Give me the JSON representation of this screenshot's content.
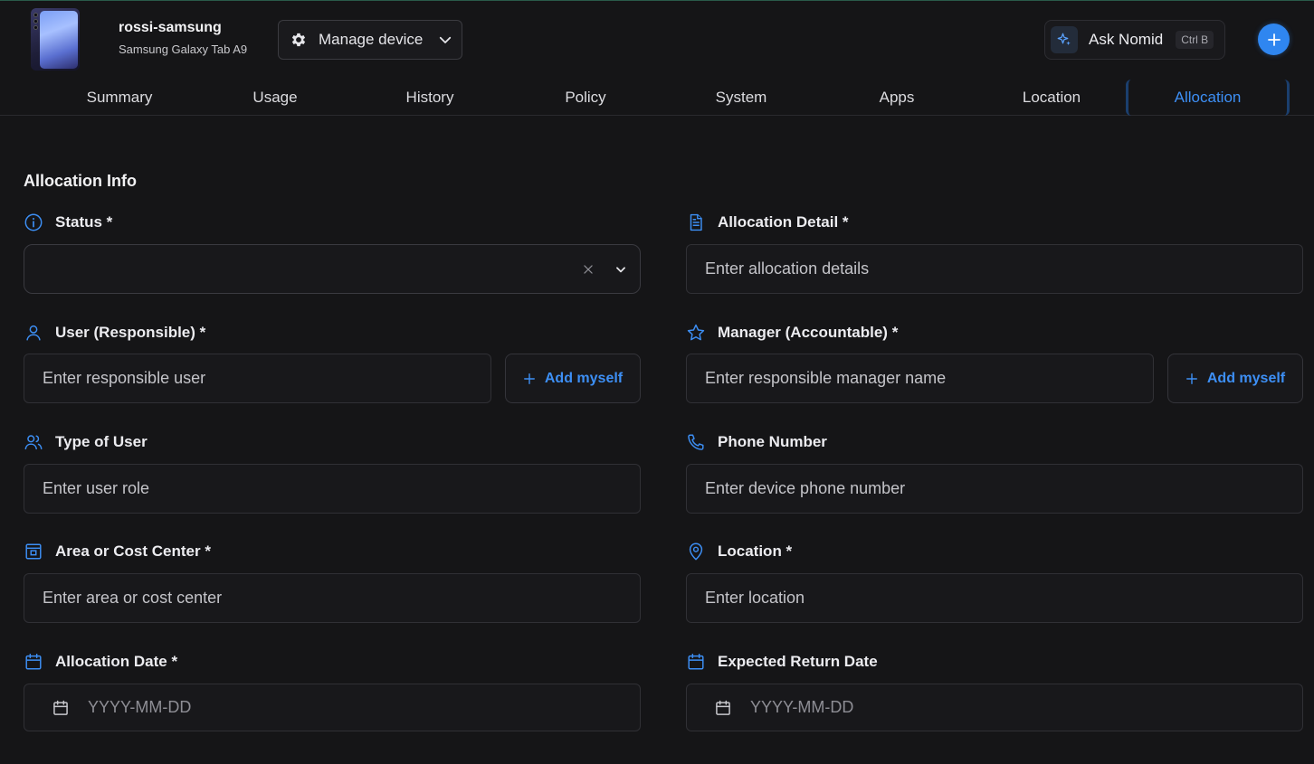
{
  "device": {
    "name": "rossi-samsung",
    "model": "Samsung Galaxy Tab A9",
    "manage_label": "Manage device"
  },
  "assistant": {
    "label": "Ask Nomid",
    "shortcut": "Ctrl B"
  },
  "tabs": [
    {
      "label": "Summary"
    },
    {
      "label": "Usage"
    },
    {
      "label": "History"
    },
    {
      "label": "Policy"
    },
    {
      "label": "System"
    },
    {
      "label": "Apps"
    },
    {
      "label": "Location"
    },
    {
      "label": "Allocation",
      "active": true
    }
  ],
  "form": {
    "title": "Allocation Info",
    "status": {
      "label": "Status *",
      "value": ""
    },
    "allocation_detail": {
      "label": "Allocation Detail *",
      "placeholder": "Enter allocation details"
    },
    "user": {
      "label": "User (Responsible) *",
      "placeholder": "Enter responsible user",
      "add_myself": "Add myself"
    },
    "manager": {
      "label": "Manager (Accountable) *",
      "placeholder": "Enter responsible manager name",
      "add_myself": "Add myself"
    },
    "user_type": {
      "label": "Type of User",
      "placeholder": "Enter user role"
    },
    "phone": {
      "label": "Phone Number",
      "placeholder": "Enter device phone number"
    },
    "cost_center": {
      "label": "Area or Cost Center *",
      "placeholder": "Enter area or cost center"
    },
    "location": {
      "label": "Location *",
      "placeholder": "Enter location"
    },
    "allocation_date": {
      "label": "Allocation Date *",
      "placeholder": "YYYY-MM-DD"
    },
    "return_date": {
      "label": "Expected Return Date",
      "placeholder": "YYYY-MM-DD"
    }
  },
  "colors": {
    "accent": "#3d8ff5",
    "background": "#151517",
    "primary_button": "#2f86f0"
  }
}
